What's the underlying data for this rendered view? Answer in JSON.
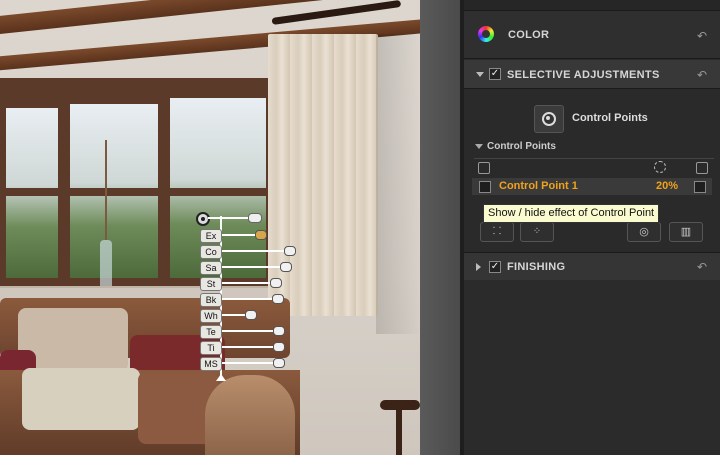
{
  "panel": {
    "color": {
      "title": "COLOR",
      "reset_icon": "reset-arrow-icon"
    },
    "selective": {
      "title": "SELECTIVE ADJUSTMENTS",
      "checked": true,
      "control_points_button_label": "Control Points",
      "list_header": "Control Points",
      "rows": [
        {
          "name": "Control Point 1",
          "opacity": "20%",
          "name_color": "#f0a21b"
        }
      ]
    },
    "finishing": {
      "title": "FINISHING",
      "checked": true
    }
  },
  "tooltip": {
    "text": "Show / hide effect of Control Point"
  },
  "control_point_overlay": {
    "sliders": [
      {
        "label": "Ex"
      },
      {
        "label": "Co"
      },
      {
        "label": "Sa"
      },
      {
        "label": "St"
      },
      {
        "label": "Bk"
      },
      {
        "label": "Wh"
      },
      {
        "label": "Te"
      },
      {
        "label": "Ti"
      },
      {
        "label": "MS"
      }
    ]
  },
  "colors": {
    "accent": "#f0a21b",
    "panel_bg": "#2a2a2a",
    "section_bg": "#333333"
  }
}
